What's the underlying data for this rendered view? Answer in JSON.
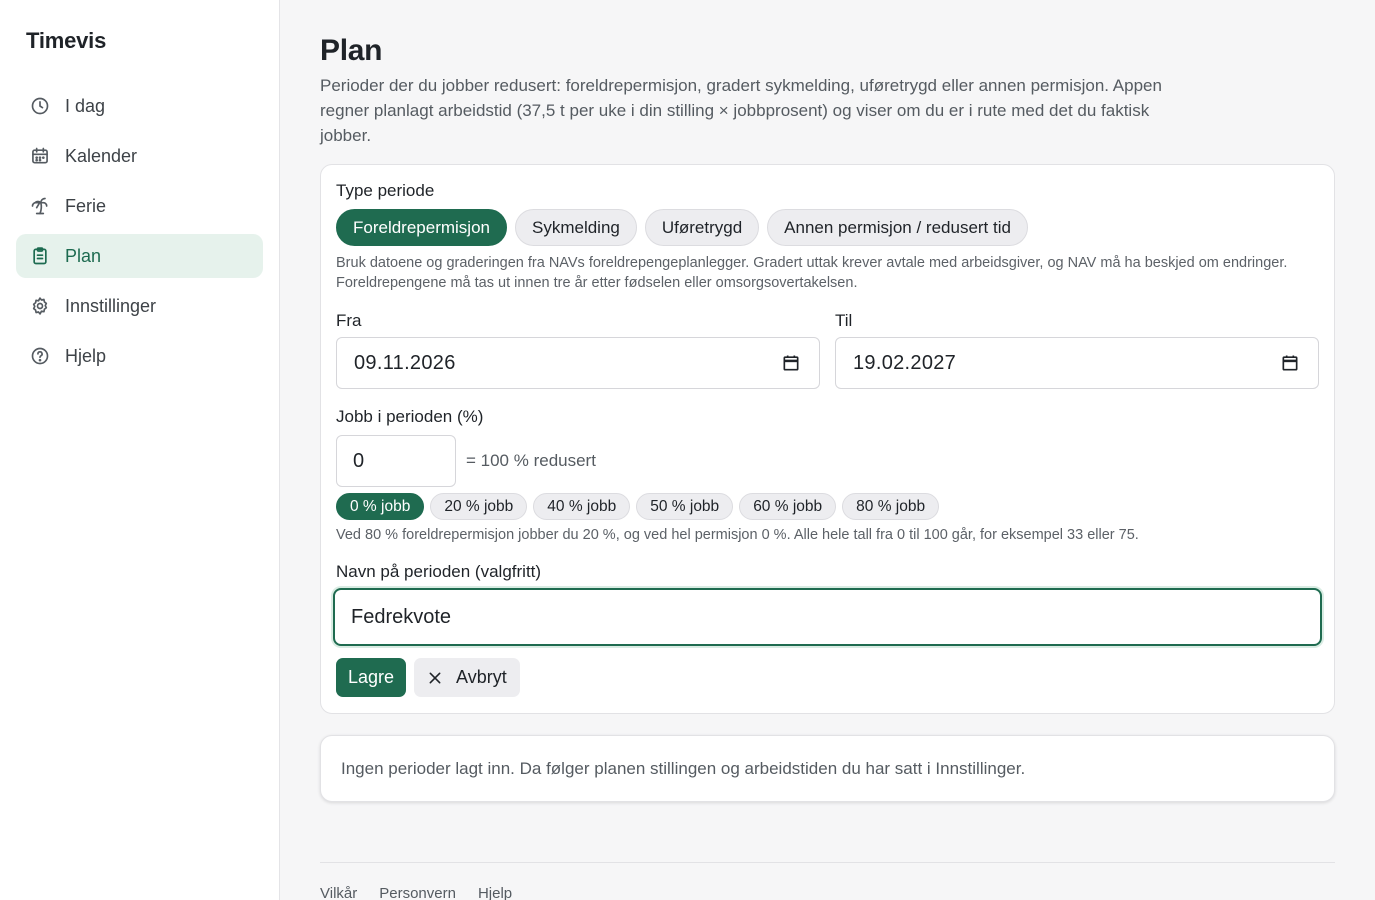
{
  "app": {
    "brand": "Timevis"
  },
  "sidebar": {
    "items": [
      {
        "label": "I dag",
        "icon": "clock-icon"
      },
      {
        "label": "Kalender",
        "icon": "calendar-icon"
      },
      {
        "label": "Ferie",
        "icon": "palm-tree-icon"
      },
      {
        "label": "Plan",
        "icon": "clipboard-icon",
        "active": true
      },
      {
        "label": "Innstillinger",
        "icon": "gear-icon"
      },
      {
        "label": "Hjelp",
        "icon": "help-circle-icon"
      }
    ]
  },
  "page": {
    "title": "Plan",
    "intro": "Perioder der du jobber redusert: foreldrepermisjon, gradert sykmelding, uføretrygd eller annen permisjon. Appen regner planlagt arbeidstid (37,5 t per uke i din stilling × jobbprosent) og viser om du er i rute med det du faktisk jobber."
  },
  "form": {
    "type_label": "Type periode",
    "types": [
      "Foreldrepermisjon",
      "Sykmelding",
      "Uføretrygd",
      "Annen permisjon / redusert tid"
    ],
    "selected_type": "Foreldrepermisjon",
    "type_help": "Bruk datoene og graderingen fra NAVs foreldrepengeplanlegger. Gradert uttak krever avtale med arbeidsgiver, og NAV må ha beskjed om endringer. Foreldrepengene må tas ut innen tre år etter fødselen eller omsorgsovertakelsen.",
    "from_label": "Fra",
    "from_value": "09.11.2026",
    "to_label": "Til",
    "to_value": "19.02.2027",
    "pct_label": "Jobb i perioden (%)",
    "pct_value": "0",
    "pct_note": "= 100 % redusert",
    "pct_presets": [
      "0 % jobb",
      "20 % jobb",
      "40 % jobb",
      "50 % jobb",
      "60 % jobb",
      "80 % jobb"
    ],
    "pct_selected": "0 % jobb",
    "pct_help": "Ved 80 % foreldrepermisjon jobber du 20 %, og ved hel permisjon 0 %. Alle hele tall fra 0 til 100 går, for eksempel 33 eller 75.",
    "name_label": "Navn på perioden (valgfritt)",
    "name_value": "Fedrekvote",
    "save_label": "Lagre",
    "cancel_label": "Avbryt"
  },
  "empty_state": "Ingen perioder lagt inn. Da følger planen stillingen og arbeidstiden du har satt i Innstillinger.",
  "footer": {
    "links": [
      "Vilkår",
      "Personvern",
      "Hjelp"
    ]
  },
  "colors": {
    "accent": "#1f6b50",
    "accent_light": "#e6f2ec"
  }
}
